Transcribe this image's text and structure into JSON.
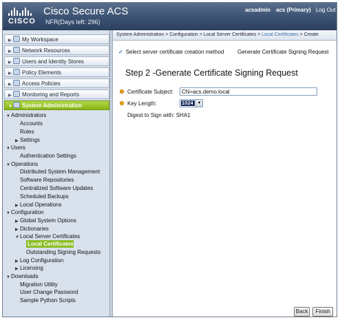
{
  "header": {
    "app_title": "Cisco Secure ACS",
    "subtitle": "NFR(Days left: 296)",
    "brand": "CISCO",
    "user": "acsadmin",
    "server": "acs (Primary)",
    "logout": "Log Out"
  },
  "drawers": [
    {
      "label": "My Workspace",
      "icon": "workspace-icon"
    },
    {
      "label": "Network Resources",
      "icon": "network-icon"
    },
    {
      "label": "Users and Identity Stores",
      "icon": "users-icon"
    },
    {
      "label": "Policy Elements",
      "icon": "policy-icon"
    },
    {
      "label": "Access Policies",
      "icon": "access-icon"
    },
    {
      "label": "Monitoring and Reports",
      "icon": "monitoring-icon"
    },
    {
      "label": "System Administration",
      "icon": "admin-icon",
      "active": true
    }
  ],
  "tree": [
    "Administrators",
    "Accounts",
    "Roles",
    "Settings",
    "Users",
    "Authentication Settings",
    "Operations",
    "Distributed System Management",
    "Software Repositories",
    "Centralized Software Updates",
    "Scheduled Backups",
    "Local Operations",
    "Configuration",
    "Global System Options",
    "Dictionaries",
    "Local Server Certificates",
    "Local Certificates",
    "Outstanding Signing Requests",
    "Log Configuration",
    "Licensing",
    "Downloads",
    "Migration Utility",
    "User Change Password",
    "Sample Python Scripts"
  ],
  "breadcrumb": {
    "part1": "System Administration",
    "part2": "Configuration",
    "part3": "Local Server Certificates",
    "part4": "Local Certificates",
    "part5": "Create",
    "sep": " > "
  },
  "wizard": {
    "prev_step": "Select server certificate creation method",
    "current_step": "Generate Certificate Signing Request",
    "heading": "Step 2 -Generate Certificate Signing Request"
  },
  "form": {
    "subject_label": "Certificate Subject:",
    "subject_value": "CN=acs.demo.local",
    "keylen_label": "Key Length:",
    "keylen_value": "1024",
    "digest_label": "Digest to Sign with:",
    "digest_value": "SHA1"
  },
  "buttons": {
    "back": "Back",
    "finish": "Finish"
  },
  "colors": {
    "header": "#3f5676",
    "active_green": "#8bbd23",
    "required": "#f0a000",
    "link": "#3a6ea5"
  }
}
